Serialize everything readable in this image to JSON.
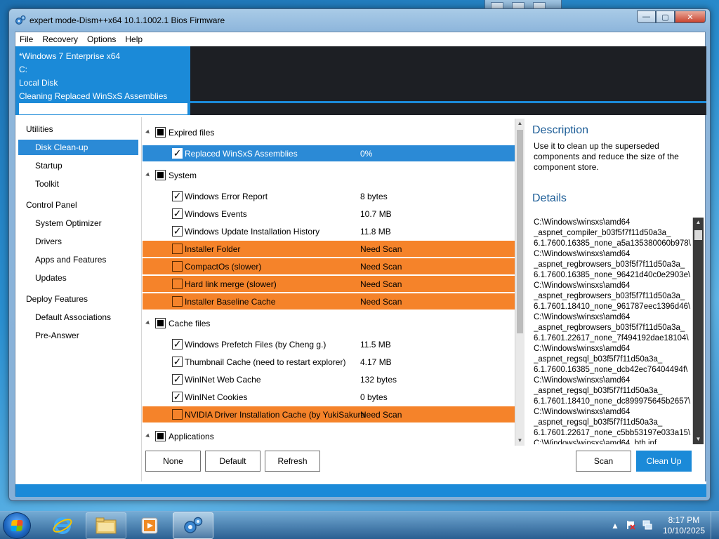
{
  "window": {
    "title": "expert mode-Dism++x64 10.1.1002.1 Bios Firmware",
    "caption_minimize": "—",
    "caption_maximize": "▢",
    "caption_close": "✕"
  },
  "menu": [
    "File",
    "Recovery",
    "Options",
    "Help"
  ],
  "header": {
    "os": "*Windows 7 Enterprise x64",
    "drive": "C:",
    "disk": "Local Disk",
    "task": "Cleaning Replaced WinSxS Assemblies",
    "progress": 1.0
  },
  "sidebar": {
    "utilities": "Utilities",
    "disk_cleanup": "Disk Clean-up",
    "startup": "Startup",
    "toolkit": "Toolkit",
    "control_panel": "Control Panel",
    "system_optimizer": "System Optimizer",
    "drivers": "Drivers",
    "apps_features": "Apps and Features",
    "updates": "Updates",
    "deploy_features": "Deploy Features",
    "default_associations": "Default Associations",
    "pre_answer": "Pre-Answer"
  },
  "list": {
    "expired": {
      "label": "Expired files",
      "items": [
        {
          "label": "Replaced WinSxS Assemblies",
          "size": "0%",
          "check": "✓"
        }
      ]
    },
    "system": {
      "label": "System",
      "items": [
        {
          "label": "Windows Error Report",
          "size": "8 bytes",
          "check": "✓"
        },
        {
          "label": "Windows Events",
          "size": "10.7 MB",
          "check": "✓"
        },
        {
          "label": "Windows Update Installation History",
          "size": "11.8 MB",
          "check": "✓"
        },
        {
          "label": "Installer Folder",
          "size": "Need Scan",
          "check": ""
        },
        {
          "label": "CompactOs (slower)",
          "size": "Need Scan",
          "check": ""
        },
        {
          "label": "Hard link merge (slower)",
          "size": "Need Scan",
          "check": ""
        },
        {
          "label": "Installer Baseline Cache",
          "size": "Need Scan",
          "check": ""
        }
      ]
    },
    "cache": {
      "label": "Cache files",
      "items": [
        {
          "label": "Windows Prefetch Files (by Cheng g.)",
          "size": "11.5 MB",
          "check": "✓"
        },
        {
          "label": "Thumbnail Cache (need to restart explorer)",
          "size": "4.17 MB",
          "check": "✓"
        },
        {
          "label": "WinINet Web Cache",
          "size": "132 bytes",
          "check": "✓"
        },
        {
          "label": "WinINet Cookies",
          "size": "0 bytes",
          "check": "✓"
        },
        {
          "label": "NVIDIA Driver Installation Cache (by YukiSakura",
          "size": "Need Scan",
          "check": ""
        }
      ]
    },
    "applications": {
      "label": "Applications"
    }
  },
  "buttons": {
    "none": "None",
    "default": "Default",
    "refresh": "Refresh",
    "scan": "Scan",
    "clean_up": "Clean Up"
  },
  "description": {
    "title": "Description",
    "text": "Use it to clean up the superseded components and reduce the size of the component store."
  },
  "details": {
    "title": "Details",
    "lines": [
      "C:\\Windows\\winsxs\\amd64",
      "_aspnet_compiler_b03f5f7f11d50a3a_",
      "6.1.7600.16385_none_a5a135380060b978\\",
      "C:\\Windows\\winsxs\\amd64",
      "_aspnet_regbrowsers_b03f5f7f11d50a3a_",
      "6.1.7600.16385_none_96421d40c0e2903e\\",
      "C:\\Windows\\winsxs\\amd64",
      "_aspnet_regbrowsers_b03f5f7f11d50a3a_",
      "6.1.7601.18410_none_961787eec1396d46\\",
      "C:\\Windows\\winsxs\\amd64",
      "_aspnet_regbrowsers_b03f5f7f11d50a3a_",
      "6.1.7601.22617_none_7f494192dae18104\\",
      "C:\\Windows\\winsxs\\amd64",
      "_aspnet_regsql_b03f5f7f11d50a3a_",
      "6.1.7600.16385_none_dcb42ec76404494f\\",
      "C:\\Windows\\winsxs\\amd64",
      "_aspnet_regsql_b03f5f7f11d50a3a_",
      "6.1.7601.18410_none_dc899975645b2657\\",
      "C:\\Windows\\winsxs\\amd64",
      "_aspnet_regsql_b03f5f7f11d50a3a_",
      "6.1.7601.22617_none_c5bb53197e033a15\\",
      "C:\\Windows\\winsxs\\amd64_bth.inf_"
    ]
  },
  "taskbar": {
    "time": "8:17 PM",
    "date": "10/10/2025",
    "tray_chevron": "▲"
  },
  "colors": {
    "accent": "#1b8ad8",
    "warning": "#f5832a",
    "header_dark": "#1d1f24"
  }
}
